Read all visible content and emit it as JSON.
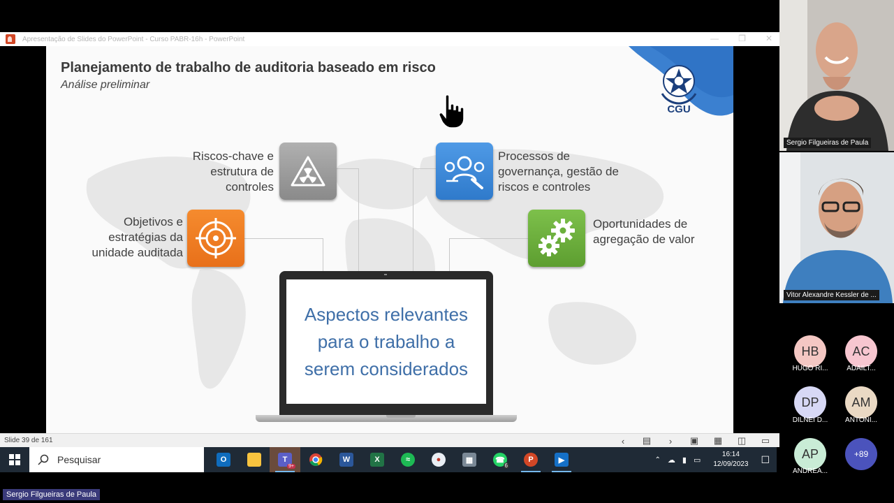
{
  "window": {
    "title": "Apresentação de Slides do PowerPoint  -  Curso PABR-16h  -  PowerPoint"
  },
  "slide": {
    "title": "Planejamento de trabalho de auditoria baseado em risco",
    "subtitle": "Análise preliminar",
    "logo_text": "CGU",
    "labels": {
      "risks": [
        "Riscos-chave e",
        "estrutura de",
        "controles"
      ],
      "objectives": [
        "Objetivos e",
        "estratégias da",
        "unidade auditada"
      ],
      "processes": [
        "Processos de",
        "governança, gestão de",
        "riscos e controles"
      ],
      "opportunities": [
        "Oportunidades de",
        "agregação de valor"
      ]
    },
    "laptop_text": [
      "Aspectos relevantes",
      "para o trabalho a",
      "serem considerados"
    ]
  },
  "statusbar": {
    "slide_counter": "Slide 39 de 161"
  },
  "taskbar": {
    "search_placeholder": "Pesquisar",
    "teams_badge": "9+",
    "whatsapp_badge": "6",
    "time": "16:14",
    "date": "12/09/2023"
  },
  "participants": {
    "video1_name": "Sergio Filgueiras de Paula",
    "video2_name": "Vitor Alexandre Kessler de ...",
    "avatars": [
      {
        "initials": "HB",
        "name": "HUGO RI...",
        "color": "#f4c7c3"
      },
      {
        "initials": "AC",
        "name": "ADAILT...",
        "color": "#f7c6d0"
      },
      {
        "initials": "DP",
        "name": "DILNEI D...",
        "color": "#d7d8f5"
      },
      {
        "initials": "AM",
        "name": "ANTONI...",
        "color": "#ead9c4"
      },
      {
        "initials": "AP",
        "name": "ANDREA...",
        "color": "#c9ecd6"
      }
    ],
    "more_count": "+89"
  },
  "presenter": "Sergio Filgueiras de Paula",
  "colors": {
    "laptop_text": "#3f6fa8",
    "cgu_blue": "#1b3f7c",
    "tile_orange": "#f58b2e",
    "tile_blue": "#3b88d8",
    "tile_green": "#6bb03c",
    "tile_gray": "#9e9e9e"
  }
}
